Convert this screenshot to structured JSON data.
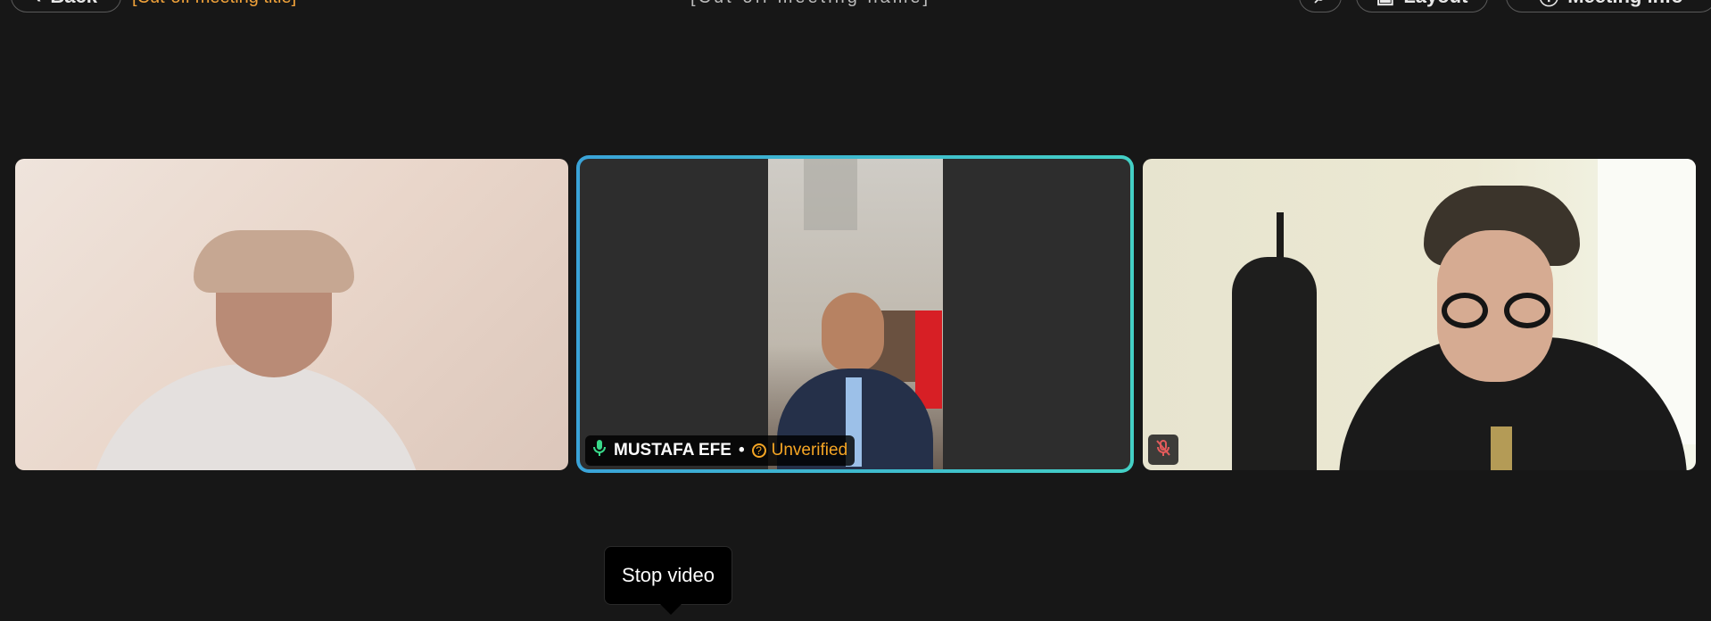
{
  "topbar": {
    "back_label": "Back",
    "title": "[Cut-off meeting title]",
    "center_label": "[Cut-off meeting name]",
    "layout_label": "Layout",
    "meeting_info_label": "Meeting info"
  },
  "participants": [
    {
      "name": "",
      "video": "on",
      "mic": "unknown"
    },
    {
      "name": "MUSTAFA EFE",
      "verification": "Unverified",
      "video": "on",
      "mic": "on",
      "active_speaker": true
    },
    {
      "name": "",
      "video": "on",
      "mic": "muted"
    }
  ],
  "tooltip": {
    "text": "Stop video"
  },
  "colors": {
    "background": "#171717",
    "active_border_start": "#3aa3d8",
    "active_border_end": "#43d0c5",
    "unverified": "#f5a524",
    "mic_on": "#39d98a"
  }
}
